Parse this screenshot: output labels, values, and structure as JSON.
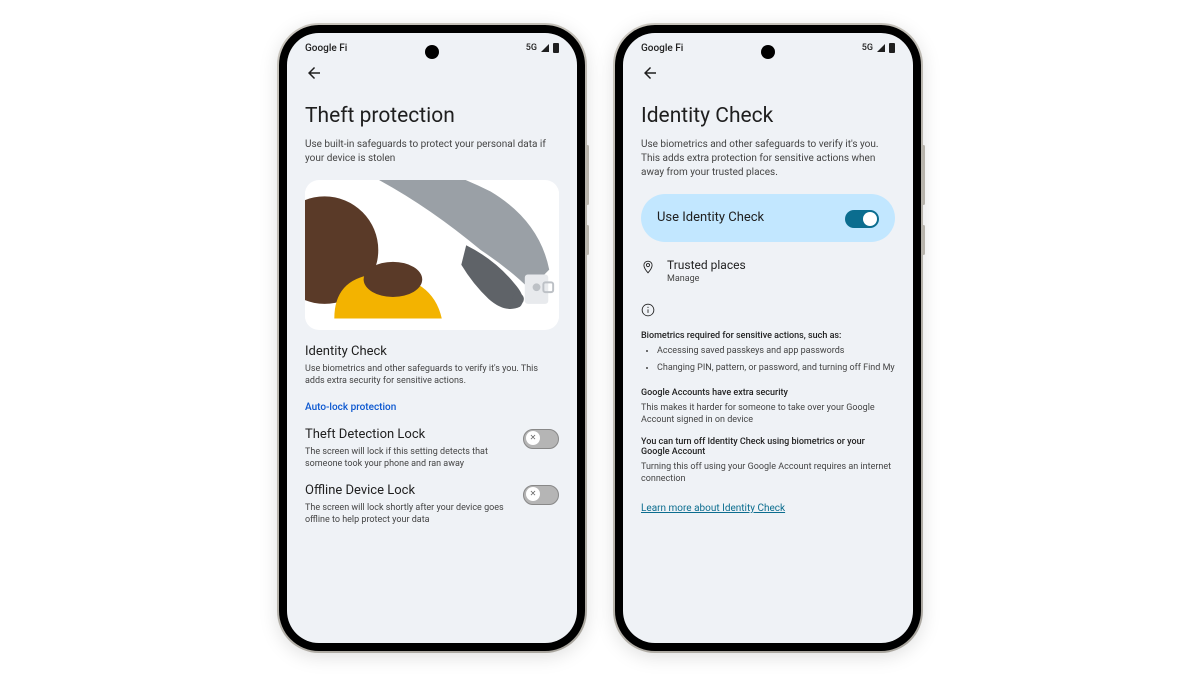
{
  "left_phone": {
    "status": {
      "carrier": "Google Fi",
      "network": "5G"
    },
    "title": "Theft protection",
    "subtitle": "Use built-in safeguards to protect your personal data if your device is stolen",
    "identity_check": {
      "title": "Identity Check",
      "desc": "Use biometrics and other safeguards to verify it's you. This adds extra security for sensitive actions."
    },
    "auto_lock_link": "Auto-lock protection",
    "theft_detection": {
      "title": "Theft Detection Lock",
      "desc": "The screen will lock if this setting detects that someone took your phone and ran away"
    },
    "offline_lock": {
      "title": "Offline Device Lock",
      "desc": "The screen will lock shortly after your device goes offline to help protect your data"
    }
  },
  "right_phone": {
    "status": {
      "carrier": "Google Fi",
      "network": "5G"
    },
    "title": "Identity Check",
    "subtitle": "Use biometrics and other safeguards to verify it's you. This adds extra protection for sensitive actions when away from your trusted places.",
    "main_toggle": {
      "label": "Use Identity Check",
      "state": "on"
    },
    "trusted_places": {
      "title": "Trusted places",
      "sub": "Manage"
    },
    "biometrics_heading": "Biometrics required for sensitive actions, such as:",
    "bullets": [
      "Accessing saved passkeys and app passwords",
      "Changing PIN, pattern, or password, and turning off Find My"
    ],
    "google_accounts_heading": "Google Accounts have extra security",
    "google_accounts_body": "This makes it harder for someone to take over your Google Account signed in on device",
    "turn_off_heading": "You can turn off Identity Check using biometrics or your Google Account",
    "turn_off_body": "Turning this off using your Google Account requires an internet connection",
    "learn_more": "Learn more about Identity Check"
  }
}
